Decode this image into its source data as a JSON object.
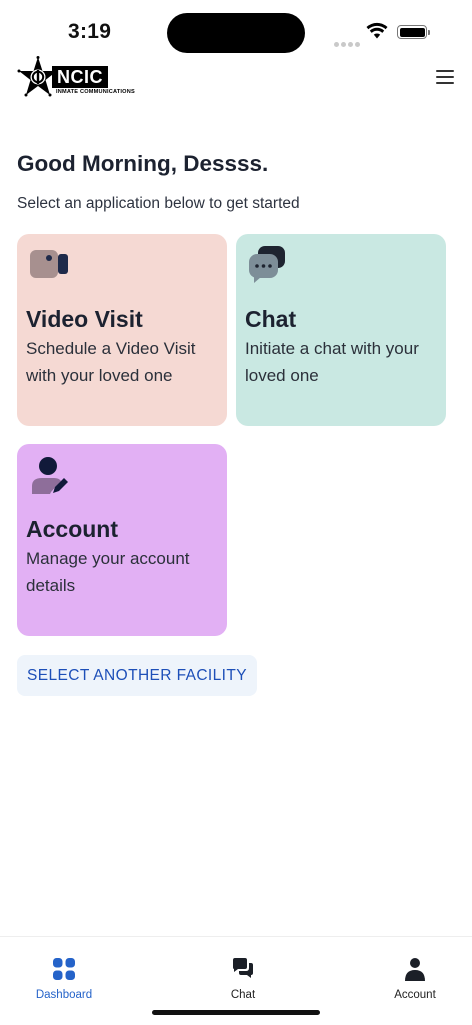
{
  "status_bar": {
    "time": "3:19"
  },
  "header": {
    "logo_text": "NCIC",
    "logo_subtext": "INMATE COMMUNICATIONS"
  },
  "greeting": "Good Morning, Dessss.",
  "subtitle": "Select an application below to get started",
  "cards": [
    {
      "title": "Video Visit",
      "description": "Schedule a Video Visit with your loved one",
      "color": "#f5d9d3",
      "icon": "video-camera-icon"
    },
    {
      "title": "Chat",
      "description": "Initiate a chat with your loved one",
      "color": "#c9e8e2",
      "icon": "chat-bubbles-icon"
    },
    {
      "title": "Account",
      "description": "Manage your account details",
      "color": "#e2b0f4",
      "icon": "user-edit-icon"
    }
  ],
  "facility_button": "SELECT ANOTHER FACILITY",
  "tabbar": {
    "active_color": "#2563c9",
    "items": [
      {
        "label": "Dashboard",
        "icon": "dashboard-grid-icon"
      },
      {
        "label": "Chat",
        "icon": "chat-icon"
      },
      {
        "label": "Account",
        "icon": "account-person-icon"
      }
    ]
  }
}
